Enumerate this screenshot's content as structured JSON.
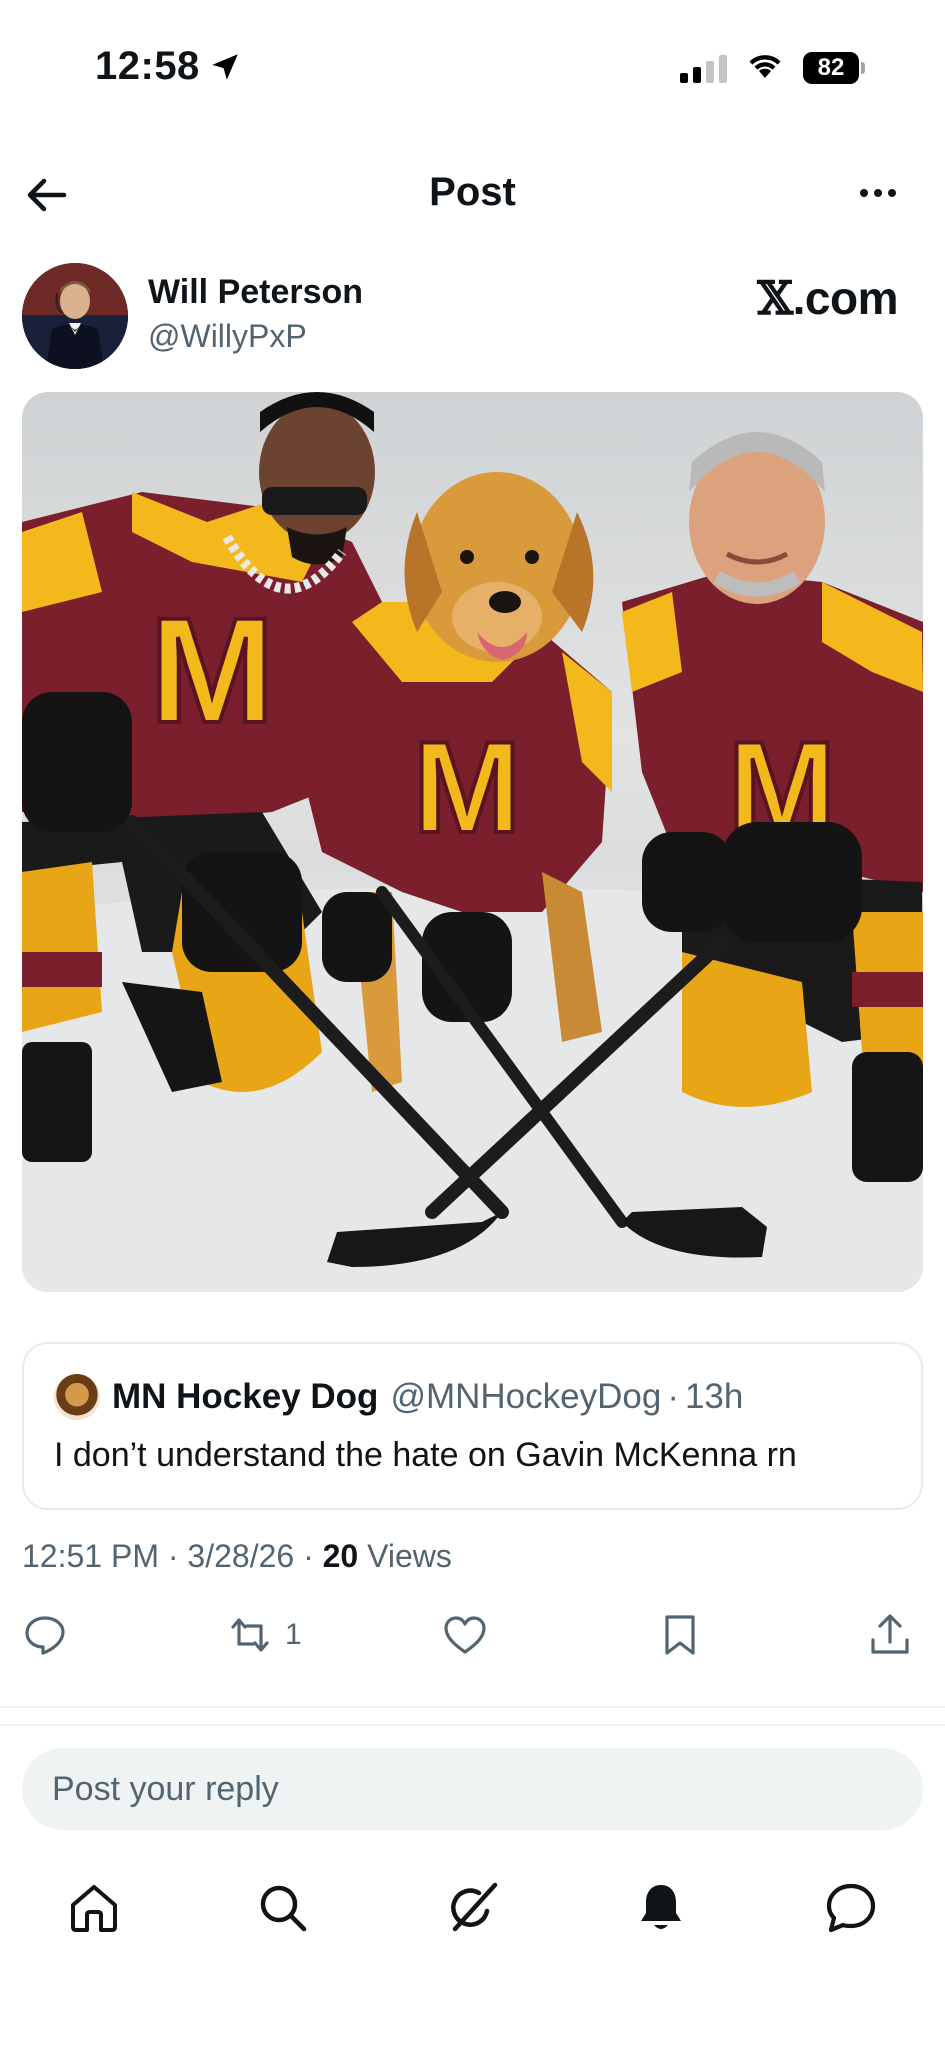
{
  "status_bar": {
    "time": "12:58",
    "battery": "82"
  },
  "header": {
    "title": "Post"
  },
  "post": {
    "author_name": "Will Peterson",
    "author_handle": "@WillyPxP",
    "watermark_mark": "𝕏",
    "watermark_text": ".com",
    "image_alt": "Photo of two men and a golden retriever in maroon and gold hockey jerseys kneeling on ice with crossed hockey sticks"
  },
  "quote": {
    "name": "MN Hockey Dog",
    "handle": "@MNHockeyDog",
    "sep": "·",
    "age": "13h",
    "text": "I don’t understand the hate on Gavin McKenna rn"
  },
  "meta": {
    "time": "12:51 PM",
    "date": "3/28/26",
    "views_count": "20",
    "views_label": "Views",
    "sep": "·"
  },
  "actions": {
    "reply_count": "",
    "repost_count": "1",
    "like_count": "",
    "icons": [
      "reply-icon",
      "repost-icon",
      "like-icon",
      "bookmark-icon",
      "share-icon"
    ]
  },
  "reply_box": {
    "placeholder": "Post your reply"
  },
  "nav": {
    "items": [
      "home-icon",
      "search-icon",
      "grok-icon",
      "notifications-icon",
      "messages-icon"
    ]
  },
  "colors": {
    "text": "#0f1419",
    "secondary": "#536471",
    "jersey_maroon": "#7a1f2b",
    "jersey_gold": "#f2b81c"
  }
}
